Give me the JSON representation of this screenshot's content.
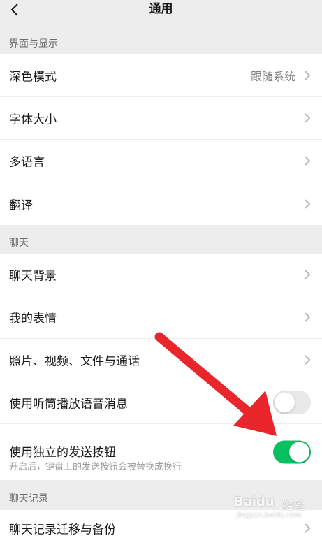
{
  "header": {
    "title": "通用",
    "back_icon": "chevron-left-icon"
  },
  "sections": {
    "display": {
      "label": "界面与显示",
      "items": [
        {
          "label": "深色模式",
          "value": "跟随系统"
        },
        {
          "label": "字体大小"
        },
        {
          "label": "多语言"
        },
        {
          "label": "翻译"
        }
      ]
    },
    "chat": {
      "label": "聊天",
      "items": [
        {
          "label": "聊天背景"
        },
        {
          "label": "我的表情"
        },
        {
          "label": "照片、视频、文件与通话"
        },
        {
          "label": "使用听筒播放语音消息",
          "toggle": false
        },
        {
          "label": "使用独立的发送按钮",
          "sublabel": "开启后，键盘上的发送按钮会被替换成换行",
          "toggle": true
        }
      ]
    },
    "history": {
      "label": "聊天记录",
      "items": [
        {
          "label": "聊天记录迁移与备份"
        }
      ]
    }
  },
  "colors": {
    "accent_green": "#07c160",
    "annotation_red": "#e8262b",
    "background": "#ededed"
  },
  "watermark": {
    "brand": "Baidu",
    "suffix": "经验",
    "url": "jingyan.baidu.com"
  }
}
